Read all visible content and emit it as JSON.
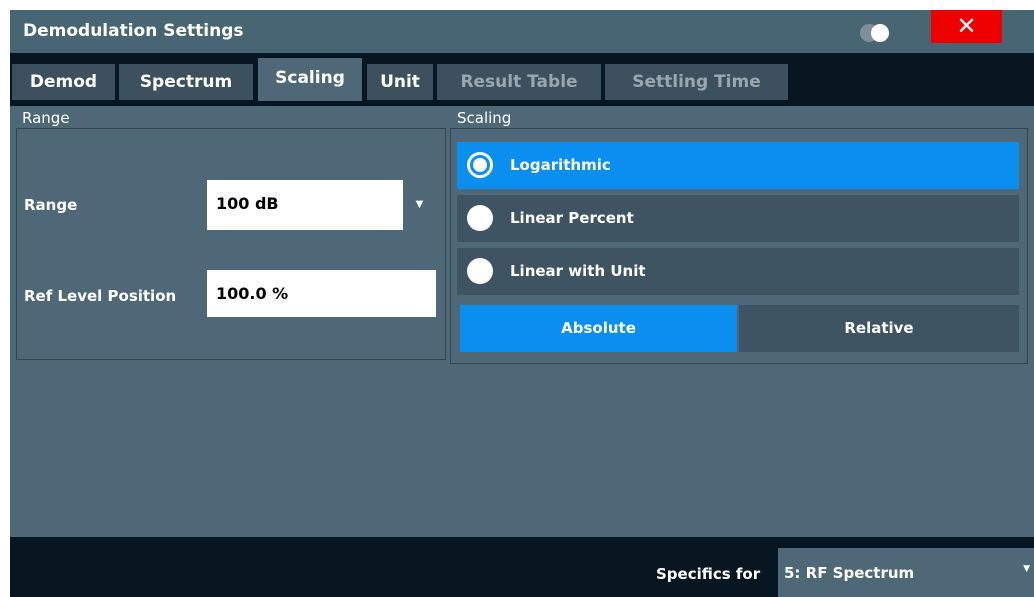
{
  "window": {
    "title": "Demodulation Settings",
    "close_symbol": "✕"
  },
  "tabs": [
    {
      "label": "Demod",
      "state": "normal"
    },
    {
      "label": "Spectrum",
      "state": "normal"
    },
    {
      "label": "Scaling",
      "state": "active"
    },
    {
      "label": "Unit",
      "state": "normal"
    },
    {
      "label": "Result Table",
      "state": "disabled"
    },
    {
      "label": "Settling Time",
      "state": "disabled"
    }
  ],
  "range_group": {
    "title": "Range",
    "range_label": "Range",
    "range_value": "100 dB",
    "ref_level_label": "Ref Level Position",
    "ref_level_value": "100.0 %"
  },
  "scaling_group": {
    "title": "Scaling",
    "options": [
      {
        "label": "Logarithmic",
        "selected": true
      },
      {
        "label": "Linear Percent",
        "selected": false
      },
      {
        "label": "Linear with Unit",
        "selected": false
      }
    ],
    "mode": {
      "absolute_label": "Absolute",
      "relative_label": "Relative",
      "selected": "Absolute"
    }
  },
  "footer": {
    "specifics_label": "Specifics for",
    "specifics_value": "5: RF Spectrum"
  },
  "colors": {
    "accent": "#0a8ff0",
    "close": "#ef0000",
    "panel": "#4e6877",
    "background": "#0a1a26"
  },
  "icons": {
    "toggle": "toggle-icon",
    "close": "close-icon",
    "dropdown": "chevron-down-icon"
  }
}
